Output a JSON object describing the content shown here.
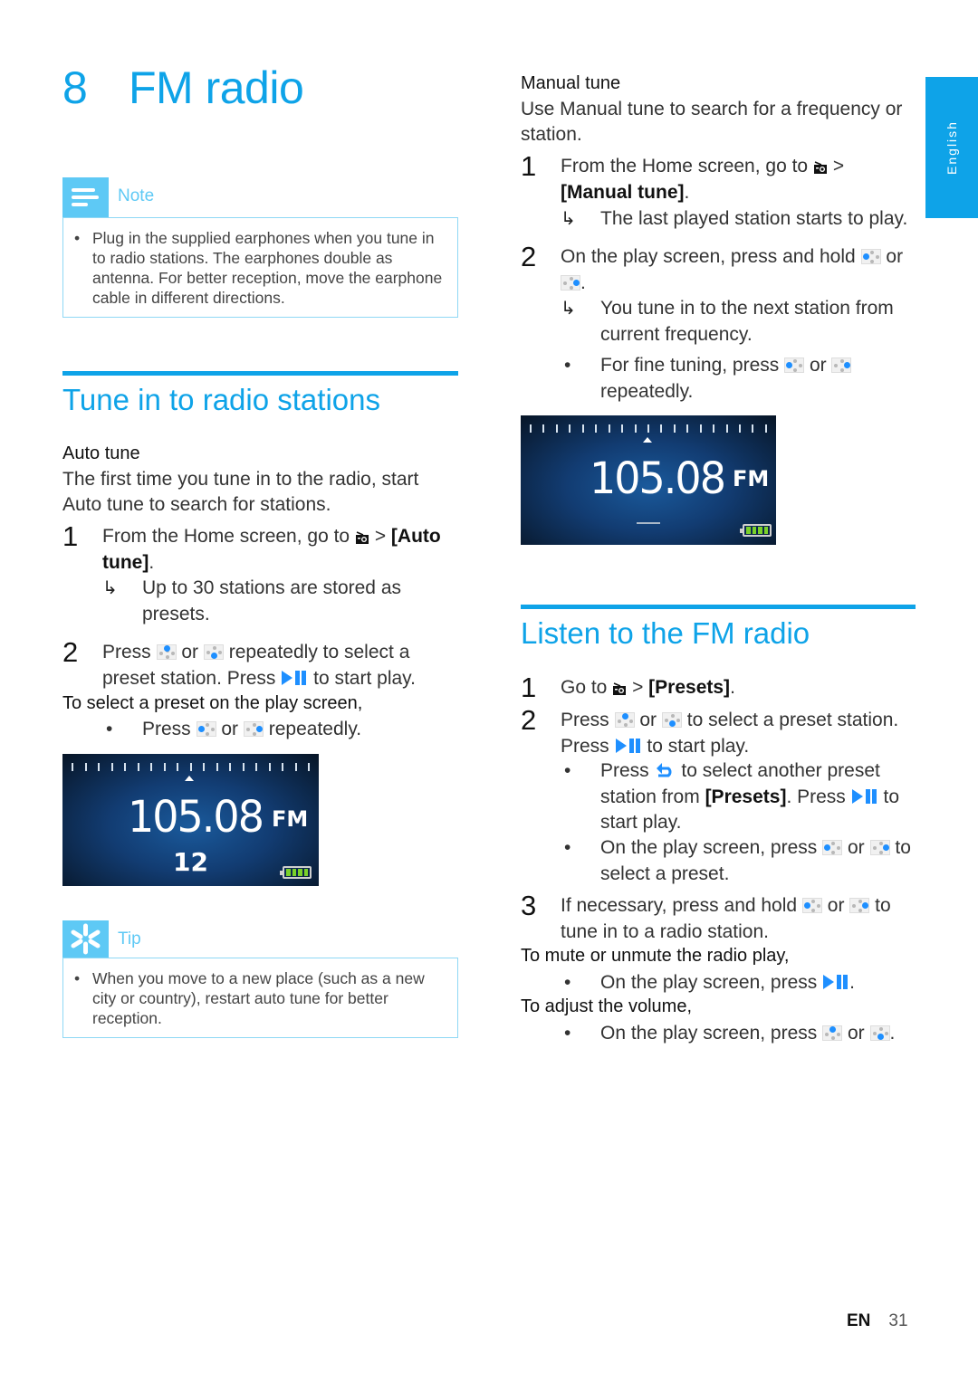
{
  "chapter": {
    "number": "8",
    "title": "FM radio"
  },
  "language_tab": "English",
  "note": {
    "label": "Note",
    "icon": "note-icon",
    "items": [
      "Plug in the supplied earphones when you tune in to radio stations. The earphones double as antenna. For better reception, move the earphone cable in different directions."
    ]
  },
  "tune_section": {
    "title": "Tune in to radio stations",
    "auto_tune": {
      "heading": "Auto tune",
      "intro": "The first time you tune in to the radio, start Auto tune to search for stations.",
      "step1": {
        "num": "1",
        "pre": "From the Home screen, go to",
        "sep": ">",
        "kw": "[Auto tune]",
        "post": "."
      },
      "step1_result": "Up to 30 stations are stored as presets.",
      "step2": {
        "num": "2",
        "a": "Press",
        "or": "or",
        "b": "repeatedly to select a preset station. Press",
        "c": "to start play."
      },
      "preset_heading": "To select a preset on the play screen,",
      "preset_bullet": {
        "a": "Press",
        "or": "or",
        "b": "repeatedly."
      }
    },
    "screen": {
      "frequency": "105.08",
      "band": "FM",
      "preset": "12",
      "battery_bars": 4
    }
  },
  "tip": {
    "label": "Tip",
    "icon": "tip-icon",
    "items": [
      "When you move to a new place (such as a new city or country), restart auto tune for better reception."
    ]
  },
  "manual_tune": {
    "heading": "Manual tune",
    "intro": "Use Manual tune to search for a frequency or station.",
    "step1": {
      "num": "1",
      "pre": "From the Home screen, go to",
      "sep": ">",
      "kw": "[Manual tune]",
      "post": "."
    },
    "step1_result": "The last played station starts to play.",
    "step2": {
      "num": "2",
      "a": "On the play screen, press and hold",
      "or": "or",
      "post": "."
    },
    "step2_result": "You tune in to the next station from current frequency.",
    "step2_bullet": {
      "a": "For fine tuning, press",
      "or": "or",
      "b": "repeatedly."
    },
    "screen": {
      "frequency": "105.08",
      "band": "FM",
      "preset": "– –",
      "battery_bars": 4
    }
  },
  "listen_section": {
    "title": "Listen to the FM radio",
    "step1": {
      "num": "1",
      "pre": "Go to",
      "sep": ">",
      "kw": "[Presets]",
      "post": "."
    },
    "step2": {
      "num": "2",
      "a": "Press",
      "or": "or",
      "b": "to select a preset station. Press",
      "c": "to start play."
    },
    "bullet1": {
      "a": "Press",
      "b": "to select another preset station from",
      "kw": "[Presets]",
      "c": ". Press",
      "d": "to start play."
    },
    "bullet2": {
      "a": "On the play screen, press",
      "or": "or",
      "b": "to select a preset."
    },
    "step3": {
      "num": "3",
      "a": "If necessary, press and hold",
      "or": "or",
      "b": "to tune in to a radio station."
    },
    "mute_heading": "To mute or unmute the radio play,",
    "mute_bullet": {
      "a": "On the play screen, press",
      "post": "."
    },
    "volume_heading": "To adjust the volume,",
    "volume_bullet": {
      "a": "On the play screen, press",
      "or": "or",
      "post": "."
    }
  },
  "footer": {
    "lang": "EN",
    "page": "31"
  },
  "colors": {
    "accent": "#0ea3e8",
    "callout": "#5ec9f5",
    "icon_blue": "#1e8fff"
  }
}
